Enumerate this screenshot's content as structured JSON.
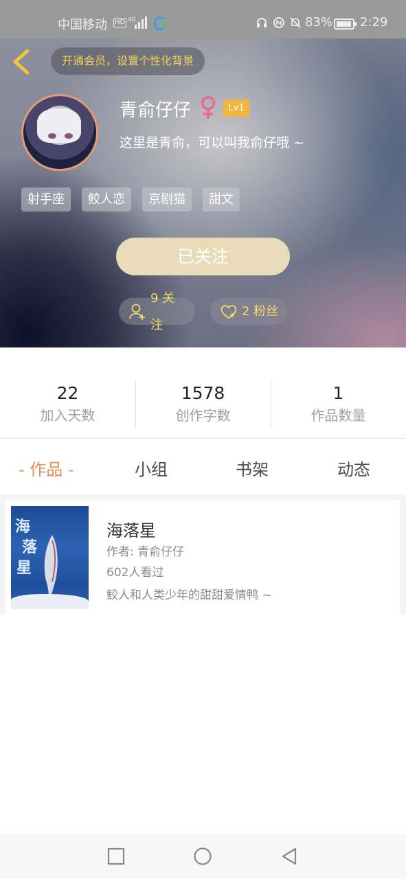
{
  "status_bar": {
    "carrier": "中国移动",
    "hd": "HD",
    "battery_percent": "83%",
    "time": "2:29"
  },
  "header": {
    "vip_prompt": "开通会员，设置个性化背景",
    "nickname": "青俞仔仔",
    "gender_icon": "female-icon",
    "level": "Lv1",
    "bio": "这里是青俞，可以叫我俞仔哦 ~",
    "tags": [
      "射手座",
      "鲛人恋",
      "京剧猫",
      "甜文"
    ],
    "follow_button": "已关注",
    "following_label": "9 关注",
    "fans_label": "2 粉丝"
  },
  "stats": [
    {
      "value": "22",
      "label": "加入天数"
    },
    {
      "value": "1578",
      "label": "创作字数"
    },
    {
      "value": "1",
      "label": "作品数量"
    }
  ],
  "tabs": [
    {
      "label": "- 作品 -",
      "active": true
    },
    {
      "label": "小组",
      "active": false
    },
    {
      "label": "书架",
      "active": false
    },
    {
      "label": "动态",
      "active": false
    }
  ],
  "works": [
    {
      "title": "海落星",
      "author": "作者: 青俞仔仔",
      "views": "602人看过",
      "description": "鲛人和人类少年的甜甜爱情鸭 ~",
      "cover_chars": [
        "海",
        "落",
        "星"
      ]
    }
  ],
  "colors": {
    "accent_orange": "#e8905a",
    "vip_yellow": "#f4d35e",
    "level_badge": "#f2b63c",
    "follow_button": "#e7dcb7"
  }
}
